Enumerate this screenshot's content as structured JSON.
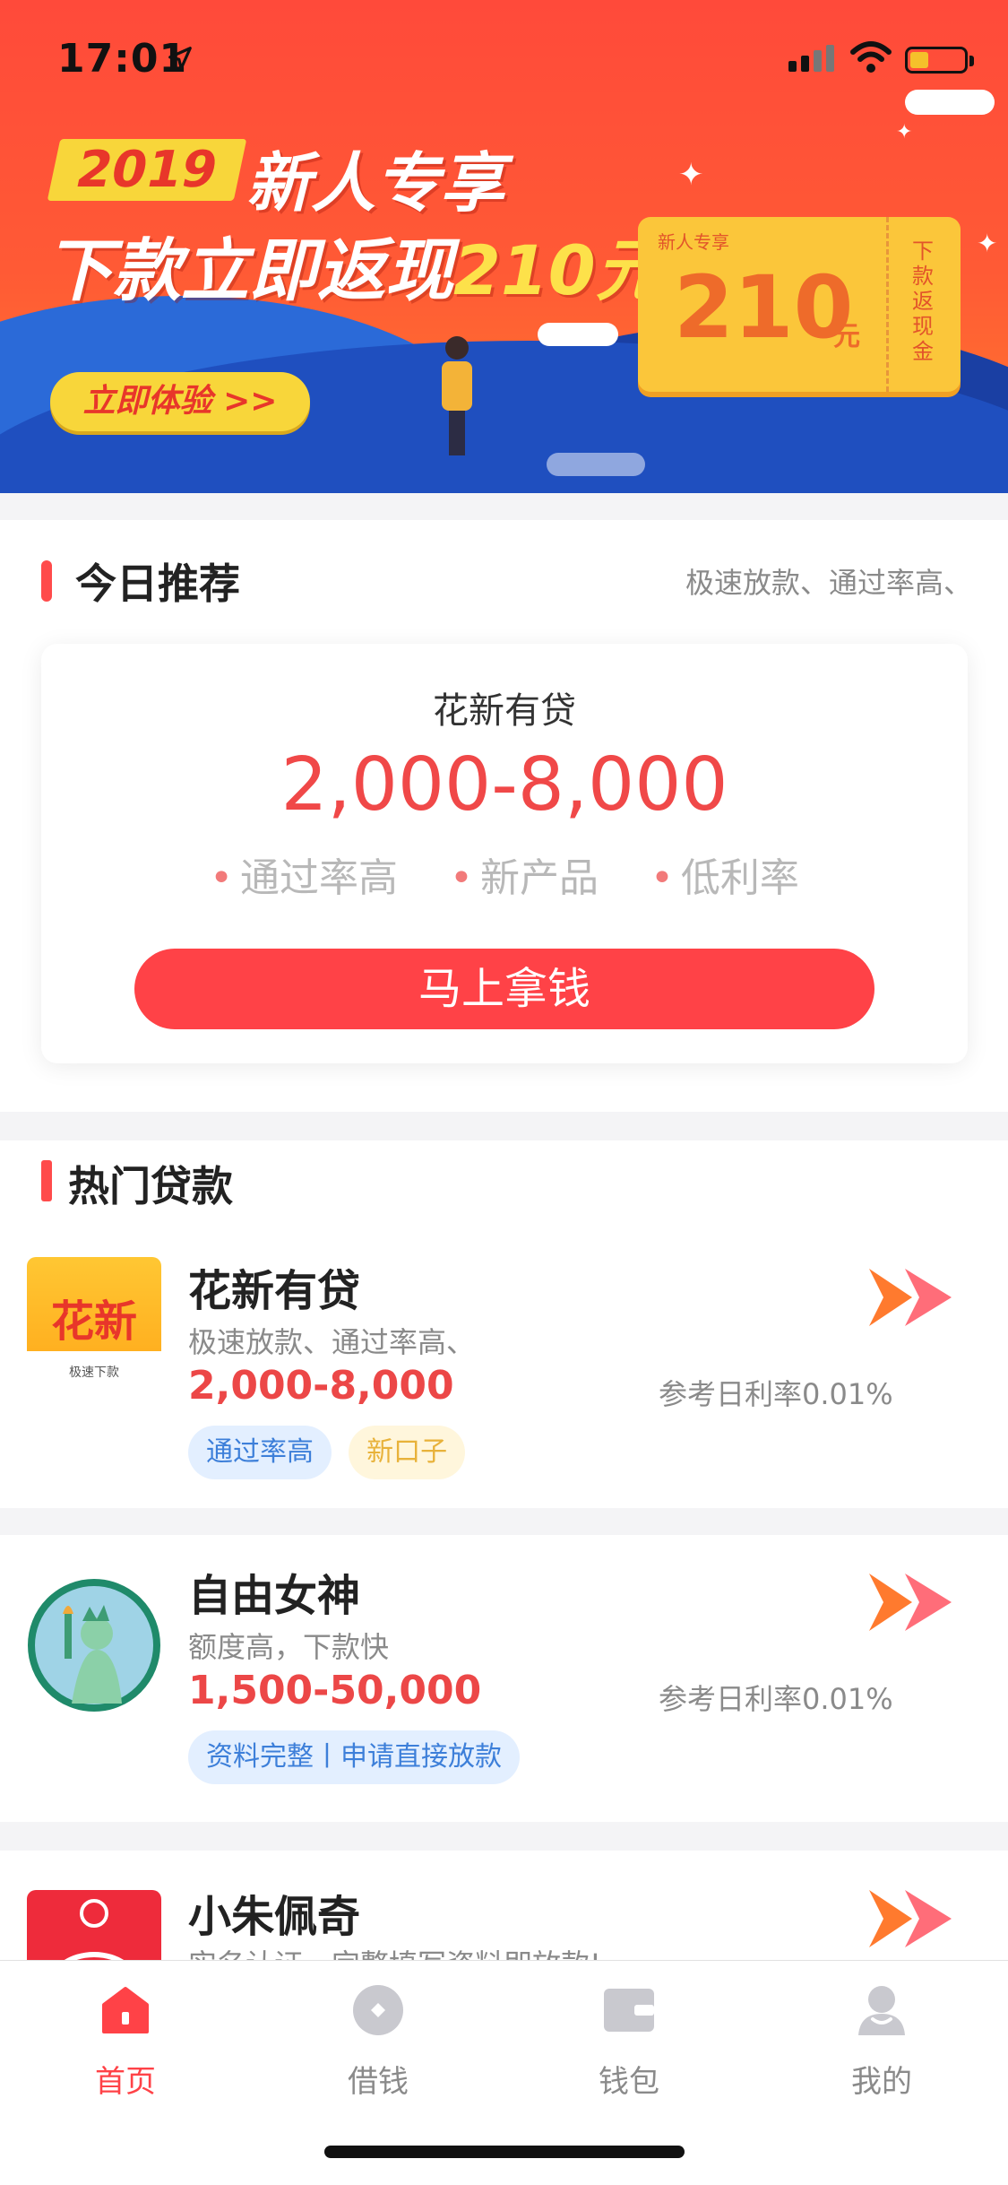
{
  "status_bar": {
    "time": "17:01"
  },
  "banner": {
    "year": "2019",
    "title_line1": "新人专享",
    "title_line2_prefix": "下款立即返现",
    "title_line2_amount": "210元",
    "cta": "立即体验 >>",
    "coupon": {
      "tag": "新人专享",
      "amount": "210",
      "unit": "元",
      "side_text": "下款返现金"
    }
  },
  "today": {
    "title": "今日推荐",
    "subtitle": "极速放款、通过率高、",
    "card": {
      "name": "花新有贷",
      "range": "2,000-8,000",
      "tags": [
        "通过率高",
        "新产品",
        "低利率"
      ],
      "button": "马上拿钱"
    }
  },
  "hot": {
    "title": "热门贷款",
    "loans": [
      {
        "name": "花新有贷",
        "logo_text": "花新",
        "logo_sub": "极速下款",
        "desc": "极速放款、通过率高、",
        "range": "2,000-8,000",
        "rate": "参考日利率0.01%",
        "tags": [
          "通过率高",
          "新口子"
        ]
      },
      {
        "name": "自由女神",
        "desc": "额度高，下款快",
        "range": "1,500-50,000",
        "rate": "参考日利率0.01%",
        "tags": [
          "资料完整丨申请直接放款"
        ]
      },
      {
        "name": "小朱佩奇",
        "desc": "实名认证，完整填写资料即放款!"
      }
    ]
  },
  "tabbar": {
    "items": [
      {
        "label": "首页",
        "icon": "home-icon",
        "active": true
      },
      {
        "label": "借钱",
        "icon": "borrow-icon",
        "active": false
      },
      {
        "label": "钱包",
        "icon": "wallet-icon",
        "active": false
      },
      {
        "label": "我的",
        "icon": "profile-icon",
        "active": false
      }
    ]
  },
  "colors": {
    "accent": "#ff4247",
    "price": "#ec4747",
    "banner_top": "#ff4a3a",
    "inactive": "#8a8a8a"
  }
}
